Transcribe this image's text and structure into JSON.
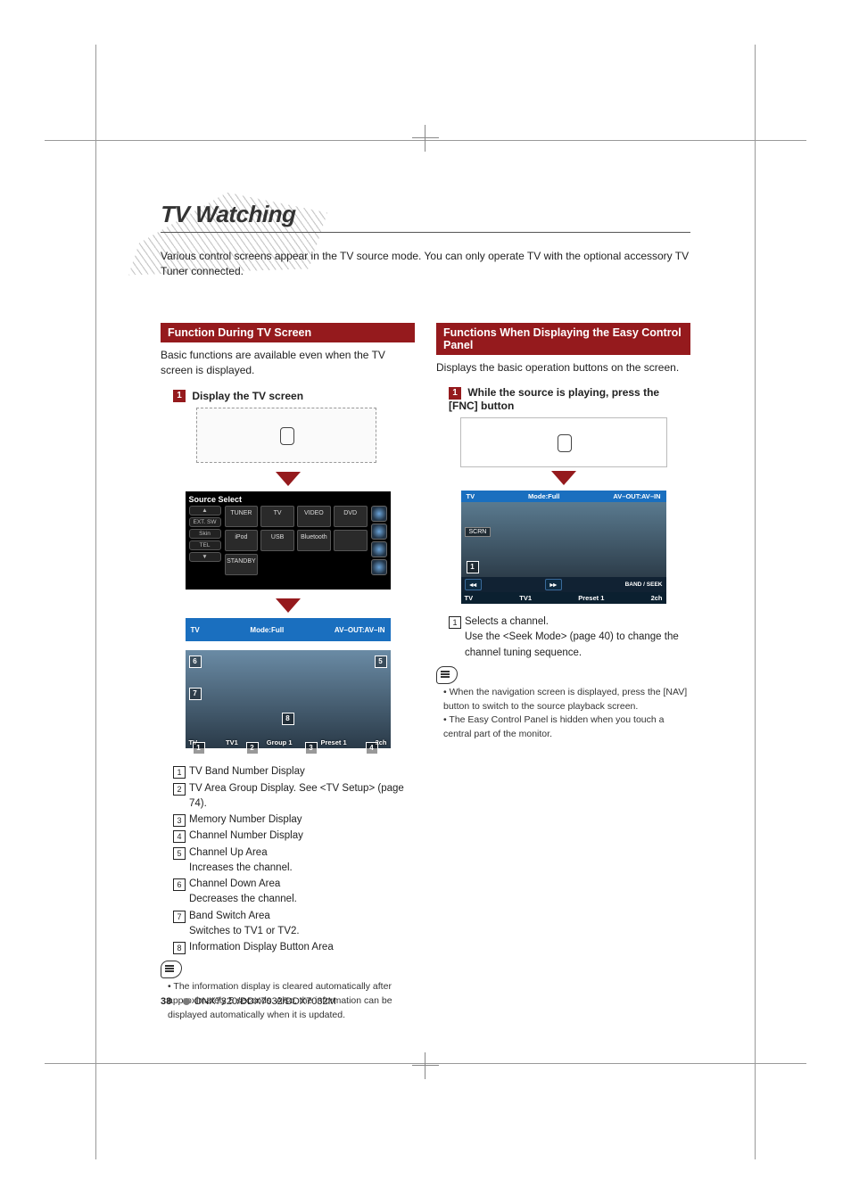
{
  "title": "TV Watching",
  "intro": "Various control screens appear in the TV source mode. You can only operate TV with the optional accessory TV Tuner connected.",
  "left": {
    "head": "Function During TV Screen",
    "body": "Basic functions are available even when the TV screen is displayed.",
    "step_label": "Display the TV screen",
    "source_select_title": "Source Select",
    "source_sidebar": [
      "▲",
      "EXT. SW",
      "Skin",
      "TEL",
      "▼"
    ],
    "source_cells": [
      "TUNER",
      "TV",
      "VIDEO",
      "DVD",
      "iPod",
      "USB",
      "Bluetooth",
      "",
      "STANDBY"
    ],
    "tv_top": {
      "left": "TV",
      "mid": "Mode:Full",
      "right": "AV–OUT:AV–IN"
    },
    "tv_bottom": {
      "tv": "TV",
      "tv1": "TV1",
      "group": "Group 1",
      "preset": "Preset 1",
      "ch": "2ch"
    },
    "keylist": [
      {
        "n": "1",
        "t": "TV Band Number Display"
      },
      {
        "n": "2",
        "t": "TV Area Group Display. See <TV Setup> (page 74)."
      },
      {
        "n": "3",
        "t": "Memory Number Display"
      },
      {
        "n": "4",
        "t": "Channel Number Display"
      },
      {
        "n": "5",
        "t": "Channel Up Area",
        "sub": "Increases the channel."
      },
      {
        "n": "6",
        "t": "Channel Down Area",
        "sub": "Decreases the channel."
      },
      {
        "n": "7",
        "t": "Band Switch Area",
        "sub": "Switches to TV1 or TV2."
      },
      {
        "n": "8",
        "t": "Information Display Button Area"
      }
    ],
    "note": "The information display is cleared automatically after approximately 5 seconds. Also, the information can be displayed automatically when it is updated."
  },
  "right": {
    "head": "Functions When Displaying the Easy Control Panel",
    "body": "Displays the basic operation buttons on the screen.",
    "step_label": "While the source is playing, press the [FNC] button",
    "panel_top": {
      "left": "TV",
      "mid": "Mode:Full",
      "right": "AV–OUT:AV–IN"
    },
    "panel_scrn": "SCRN",
    "panel_bot": {
      "tv": "TV",
      "tv1": "TV1",
      "seek": "BAND / SEEK",
      "preset": "Preset 1",
      "ch": "2ch",
      "prev": "◂◂",
      "next": "▸▸"
    },
    "keylist": [
      {
        "n": "1",
        "t": "Selects a channel.",
        "sub": "Use the <Seek Mode> (page 40) to change the channel tuning sequence."
      }
    ],
    "notes": [
      "When the navigation screen is displayed, press the [NAV] button to switch to the source playback screen.",
      "The Easy Control Panel is hidden when you touch a central part of the monitor."
    ]
  },
  "footer": {
    "page": "38",
    "model": "DNX7320/DDX7032/DDX7032M"
  }
}
